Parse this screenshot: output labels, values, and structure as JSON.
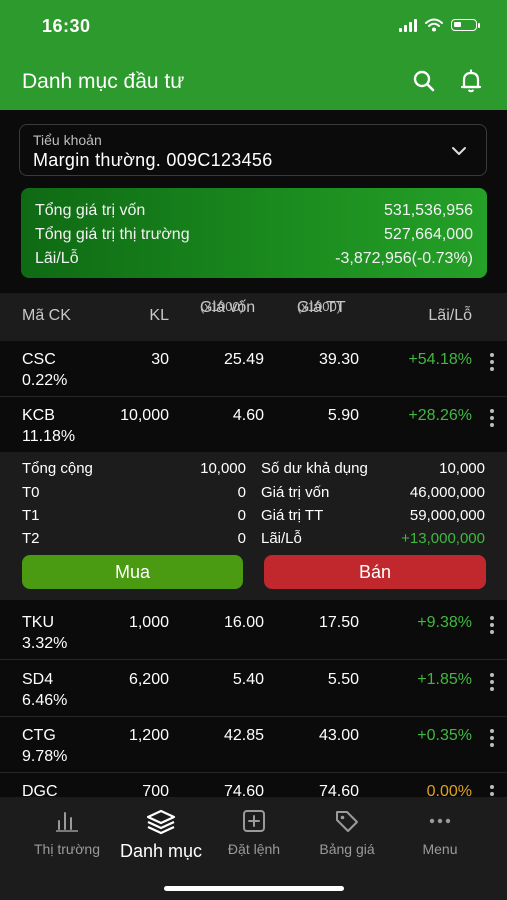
{
  "status": {
    "time": "16:30"
  },
  "header": {
    "title": "Danh mục đầu tư"
  },
  "account": {
    "label": "Tiểu khoản",
    "value": "Margin thường. 009C123456"
  },
  "summary": {
    "capital_label": "Tổng giá trị vốn",
    "capital_value": "531,536,956",
    "market_label": "Tổng giá trị thị trường",
    "market_value": "527,664,000",
    "pl_label": "Lãi/Lỗ",
    "pl_value": "-3,872,956(-0.73%)"
  },
  "table": {
    "col_code": "Mã CK",
    "col_qty": "KL",
    "col_cost": "Giá vốn",
    "col_cost_sub": "(x1000)",
    "col_price": "Giá TT",
    "col_price_sub": "(x1000)",
    "col_pl": "Lãi/Lỗ",
    "rows": [
      {
        "code": "CSC",
        "weight": "0.22%",
        "qty": "30",
        "cost": "25.49",
        "price": "39.30",
        "pl": "+54.18%"
      },
      {
        "code": "KCB",
        "weight": "11.18%",
        "qty": "10,000",
        "cost": "4.60",
        "price": "5.90",
        "pl": "+28.26%"
      },
      {
        "code": "TKU",
        "weight": "3.32%",
        "qty": "1,000",
        "cost": "16.00",
        "price": "17.50",
        "pl": "+9.38%"
      },
      {
        "code": "SD4",
        "weight": "6.46%",
        "qty": "6,200",
        "cost": "5.40",
        "price": "5.50",
        "pl": "+1.85%"
      },
      {
        "code": "CTG",
        "weight": "9.78%",
        "qty": "1,200",
        "cost": "42.85",
        "price": "43.00",
        "pl": "+0.35%"
      },
      {
        "code": "DGC",
        "weight": "",
        "qty": "700",
        "cost": "74.60",
        "price": "74.60",
        "pl": "0.00%"
      }
    ]
  },
  "detail": {
    "total_label": "Tổng cộng",
    "total_value": "10,000",
    "t0_label": "T0",
    "t0_value": "0",
    "t1_label": "T1",
    "t1_value": "0",
    "t2_label": "T2",
    "t2_value": "0",
    "avail_label": "Số dư khả dụng",
    "avail_value": "10,000",
    "cost_label": "Giá trị vốn",
    "cost_value": "46,000,000",
    "mkt_label": "Giá trị TT",
    "mkt_value": "59,000,000",
    "pl_label": "Lãi/Lỗ",
    "pl_value": "+13,000,000",
    "buy_label": "Mua",
    "sell_label": "Bán"
  },
  "tabs": [
    {
      "label": "Thị trường",
      "icon": "chart-bars-icon"
    },
    {
      "label": "Danh mục",
      "icon": "layers-icon"
    },
    {
      "label": "Đặt lệnh",
      "icon": "plus-square-icon"
    },
    {
      "label": "Bảng giá",
      "icon": "tag-icon"
    },
    {
      "label": "Menu",
      "icon": "more-dots-icon"
    }
  ],
  "colors": {
    "brand_green": "#2d9a2d",
    "gain": "#3fb93f",
    "zero": "#e0a020",
    "sell": "#c0282d",
    "buy": "#4a9a12"
  }
}
